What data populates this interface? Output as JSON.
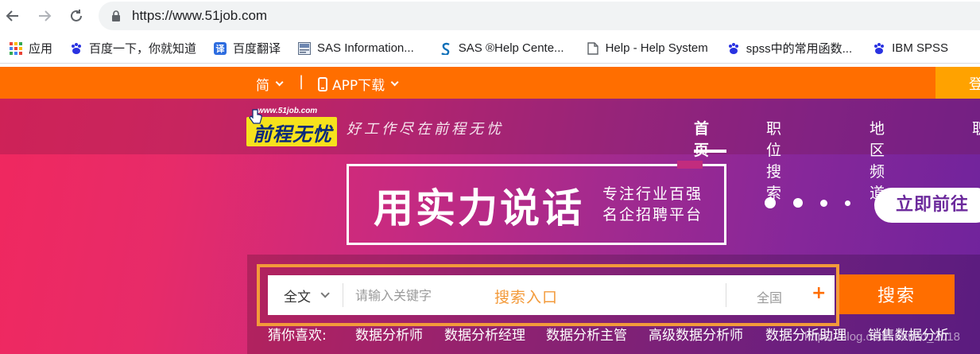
{
  "browser": {
    "url": "https://www.51job.com",
    "bookmarks": [
      {
        "icon": "apps-grid-icon",
        "label": "应用"
      },
      {
        "icon": "baidu-paw-icon",
        "label": "百度一下，你就知道"
      },
      {
        "icon": "translate-icon",
        "icon_glyph": "译",
        "label": "百度翻译"
      },
      {
        "icon": "sas-app-icon",
        "label": "SAS Information..."
      },
      {
        "icon": "sas-s-icon",
        "label": "SAS ®Help Cente..."
      },
      {
        "icon": "document-icon",
        "label": "Help - Help System"
      },
      {
        "icon": "baidu-paw-icon",
        "label": "spss中的常用函数..."
      },
      {
        "icon": "baidu-paw-icon",
        "label": "IBM SPSS"
      }
    ]
  },
  "topbar": {
    "lang_label": "简",
    "separator": "|",
    "app_label": "APP下载",
    "login_label": "登"
  },
  "header": {
    "logo_small": "www.51job.com",
    "logo_text": "前程无忧",
    "slogan": "好工作尽在前程无忧",
    "nav": [
      "首页",
      "职位搜索",
      "地区频道",
      "职"
    ]
  },
  "banner": {
    "headline": "用实力说话",
    "sub_line1": "专注行业百强",
    "sub_line2": "名企招聘平台",
    "cta_label": "立即前往"
  },
  "search": {
    "scope_label": "全文",
    "keyword_placeholder": "请输入关键字",
    "annotation": "搜索入口",
    "area_label": "全国",
    "area_add": "+",
    "button_label": "搜索"
  },
  "guess": {
    "label": "猜你喜欢:",
    "items": [
      "数据分析师",
      "数据分析经理",
      "数据分析主管",
      "高级数据分析师",
      "数据分析助理",
      "销售数据分析"
    ]
  },
  "watermark": "https://blog.csdn.net/sd_2018",
  "colors": {
    "orange": "#ff6e00",
    "annotation": "#f39a3a",
    "logo_yellow": "#f6e21c",
    "logo_blue": "#0a2a7a"
  }
}
